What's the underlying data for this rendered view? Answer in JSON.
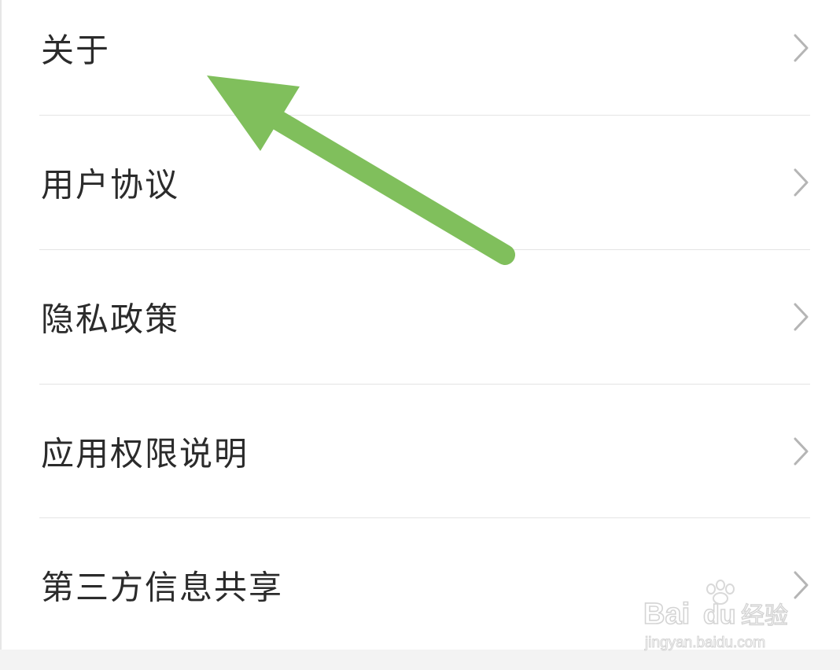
{
  "menu": {
    "items": [
      {
        "label": "关于"
      },
      {
        "label": "用户协议"
      },
      {
        "label": "隐私政策"
      },
      {
        "label": "应用权限说明"
      },
      {
        "label": "第三方信息共享"
      }
    ]
  },
  "annotation": {
    "arrow_color": "#80bf5c"
  },
  "watermark": {
    "logo_text": "Bai du 经验",
    "url_text": "jingyan.baidu.com"
  },
  "colors": {
    "text": "#2b2b2b",
    "chevron": "#b5b5b5",
    "divider": "#e4e4e4",
    "bottom_strip": "#f3f3f3"
  }
}
